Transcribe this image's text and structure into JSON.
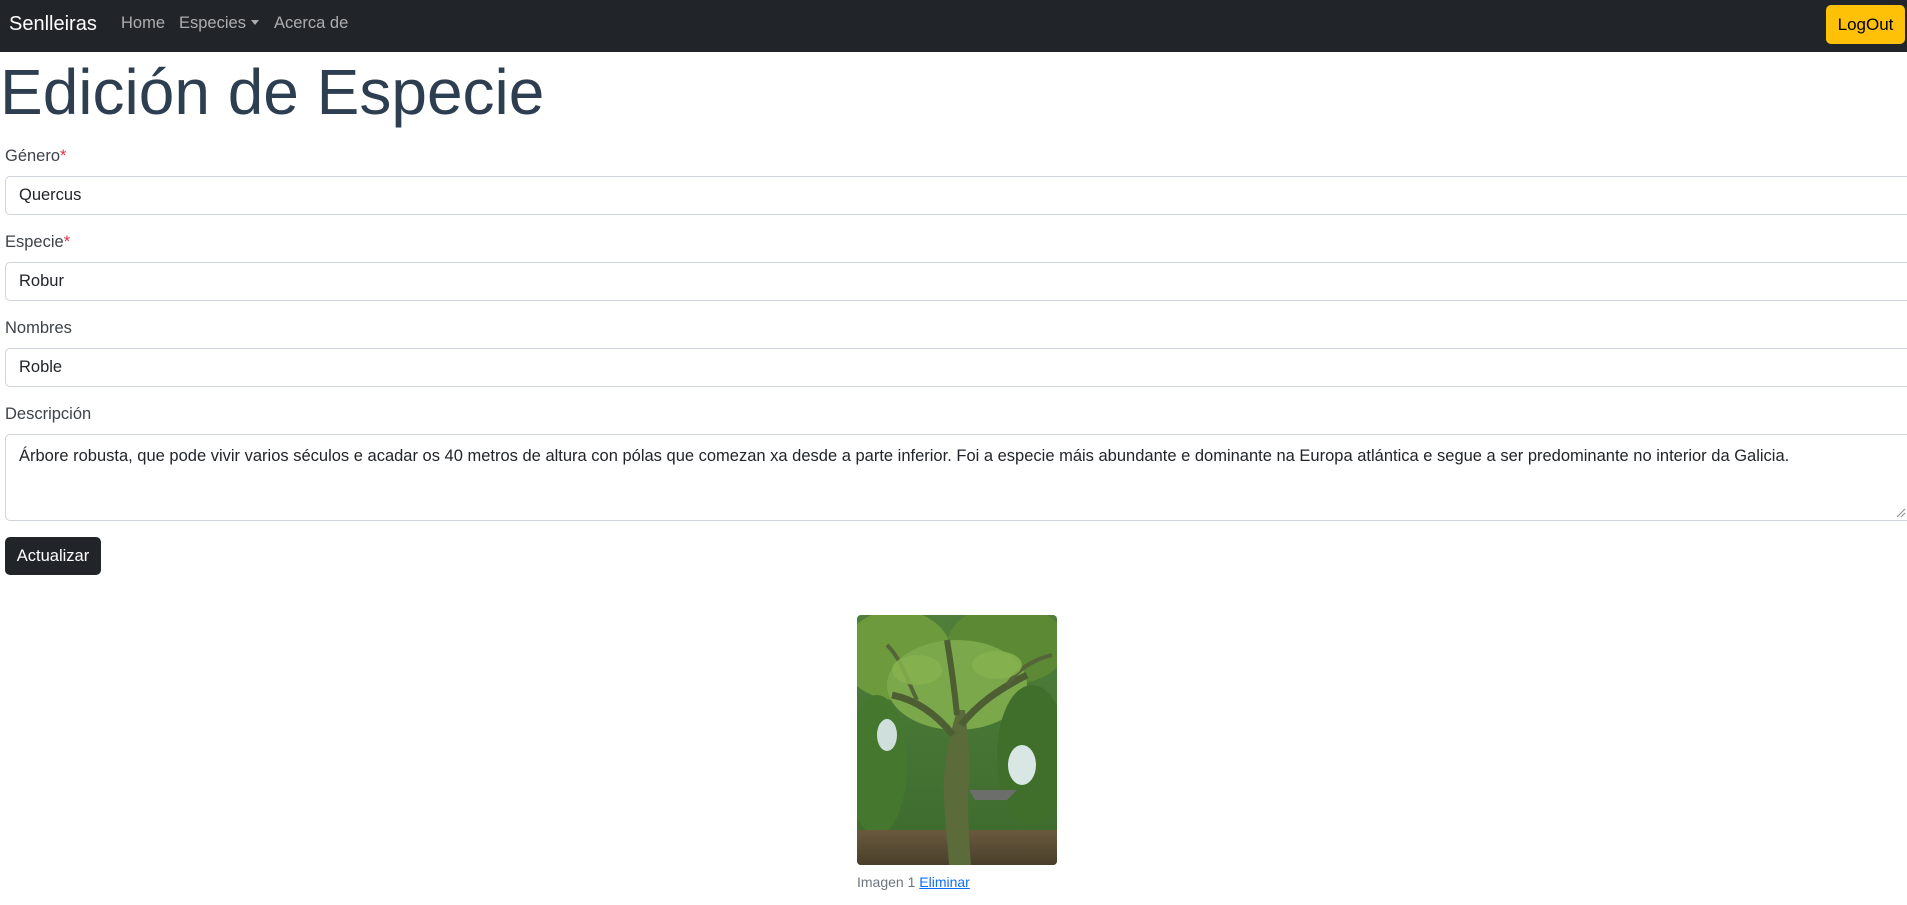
{
  "nav": {
    "brand": "Senlleiras",
    "home": "Home",
    "especies": "Especies",
    "acerca": "Acerca de",
    "logout": "LogOut"
  },
  "page": {
    "title": "Edición de Especie"
  },
  "form": {
    "required_mark": "*",
    "genero": {
      "label": "Género",
      "value": "Quercus"
    },
    "especie": {
      "label": "Especie",
      "value": "Robur"
    },
    "nombres": {
      "label": "Nombres",
      "value": "Roble"
    },
    "descripcion": {
      "label": "Descripción",
      "value": "Árbore robusta, que pode vivir varios séculos e acadar os 40 metros de altura con pólas que comezan xa desde a parte inferior. Foi a especie máis abundante e dominante na Europa atlántica e segue a ser predominante no interior da Galicia."
    },
    "submit": "Actualizar"
  },
  "images": [
    {
      "caption": "Imagen 1",
      "delete_label": "Eliminar"
    }
  ],
  "colors": {
    "navbar": "#212529",
    "logout_button": "#ffc107",
    "title": "#2c3e50",
    "required": "#dc3545",
    "link": "#0d6efd"
  },
  "icons": {
    "dropdown": "caret-down-icon",
    "resize": "resize-grip-icon"
  }
}
